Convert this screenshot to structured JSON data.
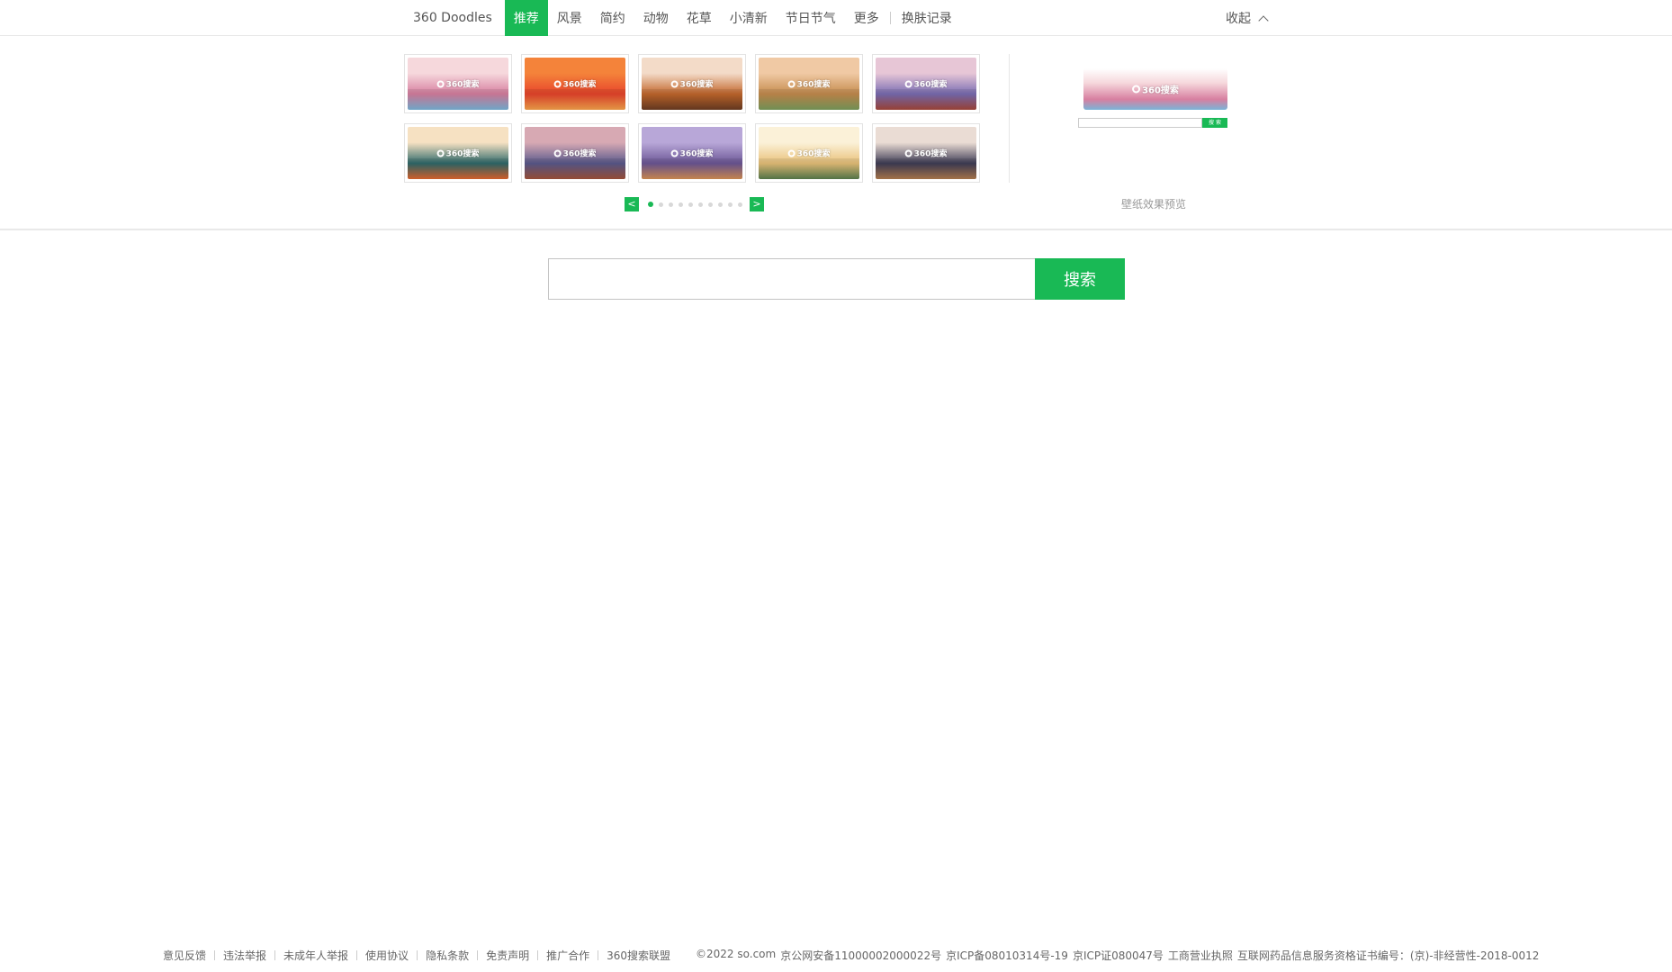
{
  "nav": {
    "brand": "360 Doodles",
    "items": [
      "推荐",
      "风景",
      "简约",
      "动物",
      "花草",
      "小清新",
      "节日节气",
      "更多"
    ],
    "active_index": 0,
    "history": "换肤记录",
    "collapse": "收起"
  },
  "gallery": {
    "thumbs": [
      {
        "logo": "360搜索",
        "colors": [
          "#f6d8dc",
          "#d77fa0",
          "#7ab4d8"
        ]
      },
      {
        "logo": "360搜索",
        "colors": [
          "#f4833a",
          "#e8452c",
          "#f7a24b"
        ]
      },
      {
        "logo": "360搜索",
        "colors": [
          "#f3dbc8",
          "#c4682d",
          "#6b3c22"
        ]
      },
      {
        "logo": "360搜索",
        "colors": [
          "#f0c9a4",
          "#c58c4e",
          "#7a9b5b"
        ]
      },
      {
        "logo": "360搜索",
        "colors": [
          "#e7c6d6",
          "#7a6db3",
          "#a4463a"
        ]
      },
      {
        "logo": "360搜索",
        "colors": [
          "#f6e1c2",
          "#2f6a6b",
          "#e0662d"
        ]
      },
      {
        "logo": "360搜索",
        "colors": [
          "#d7a9b3",
          "#5b5a8d",
          "#a0523a"
        ]
      },
      {
        "logo": "360搜索",
        "colors": [
          "#b8a7d8",
          "#6c5796",
          "#d58f55"
        ]
      },
      {
        "logo": "360搜索",
        "colors": [
          "#fbf1d8",
          "#e9c27a",
          "#5a7d4d"
        ]
      },
      {
        "logo": "360搜索",
        "colors": [
          "#eadcd4",
          "#3f3d56",
          "#b07b4f"
        ]
      }
    ],
    "prev": "<",
    "next": ">",
    "page_count": 10,
    "current_page": 1
  },
  "preview": {
    "logo": "360搜索",
    "mini_button": "搜 索",
    "label": "壁纸效果预览"
  },
  "search": {
    "button": "搜索",
    "value": ""
  },
  "footer": {
    "links": [
      "意见反馈",
      "违法举报",
      "未成年人举报",
      "使用协议",
      "隐私条款",
      "免责声明",
      "推广合作",
      "360搜索联盟"
    ],
    "copyright": "©2022 so.com",
    "beian": "京公网安备11000002000022号",
    "icp1": "京ICP备08010314号-19",
    "icp2": "京ICP证080047号",
    "license": "工商营业执照",
    "drug": "互联网药品信息服务资格证书编号：(京)-非经营性-2018-0012"
  }
}
